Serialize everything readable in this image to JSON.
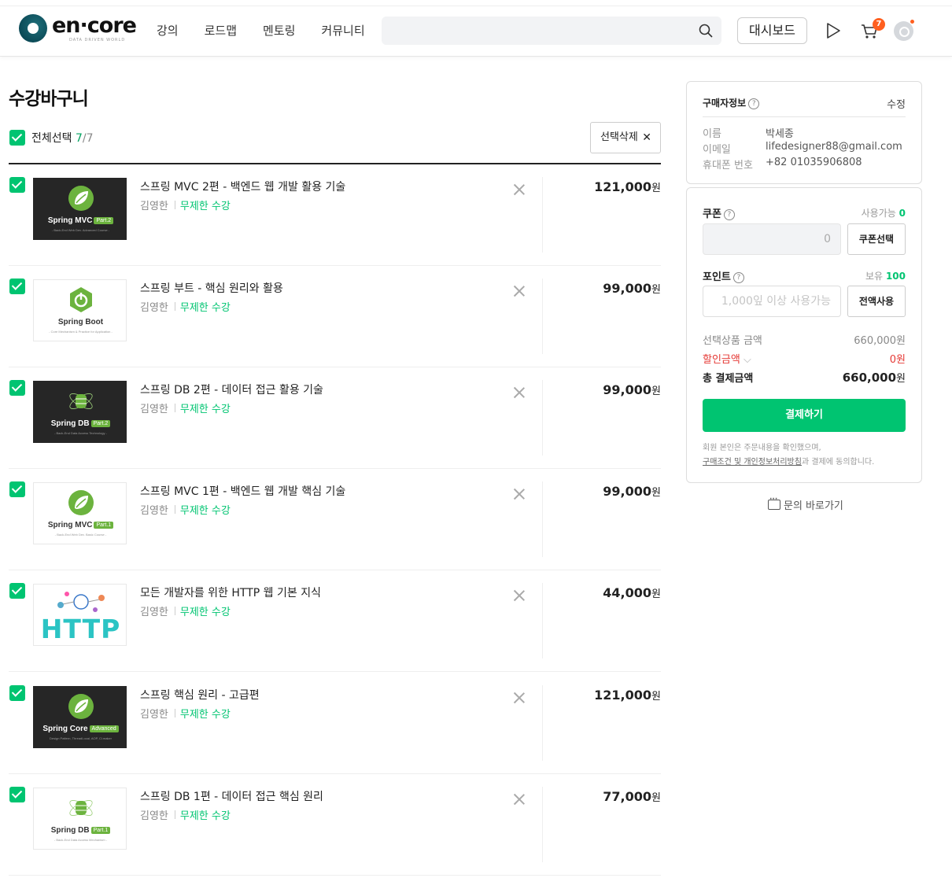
{
  "header": {
    "logo_text": "en·core",
    "logo_sub": "DATA DRIVEN WORLD",
    "nav": [
      "강의",
      "로드맵",
      "멘토링",
      "커뮤니티"
    ],
    "search_placeholder": "",
    "dashboard_label": "대시보드",
    "cart_count": "7",
    "icons": [
      "search-icon",
      "play-icon",
      "cart-icon",
      "avatar"
    ]
  },
  "cart": {
    "title": "수강바구니",
    "select_all_label": "전체선택",
    "selected_count": "7",
    "total_count": "/7",
    "delete_selected_label": "선택삭제",
    "items": [
      {
        "title": "스프링 MVC 2편 - 백엔드 웹 개발 활용 기술",
        "instructor": "김영한",
        "access": "무제한 수강",
        "price": "121,000",
        "currency": "원",
        "thumb": {
          "style": "dark",
          "label": "Spring MVC",
          "tag": "Part.2",
          "sub": "- Back-End Web Dev. Advanced Course -"
        }
      },
      {
        "title": "스프링 부트 - 핵심 원리와 활용",
        "instructor": "김영한",
        "access": "무제한 수강",
        "price": "99,000",
        "currency": "원",
        "thumb": {
          "style": "light",
          "label": "Spring Boot",
          "tag": "",
          "sub": "- Core Mechanism & Practice for Application -"
        }
      },
      {
        "title": "스프링 DB 2편 - 데이터 접근 활용 기술",
        "instructor": "김영한",
        "access": "무제한 수강",
        "price": "99,000",
        "currency": "원",
        "thumb": {
          "style": "dark",
          "label": "Spring DB",
          "tag": "Part.2",
          "sub": "- Back-End Data Access Technology -"
        }
      },
      {
        "title": "스프링 MVC 1편 - 백엔드 웹 개발 핵심 기술",
        "instructor": "김영한",
        "access": "무제한 수강",
        "price": "99,000",
        "currency": "원",
        "thumb": {
          "style": "light",
          "label": "Spring MVC",
          "tag": "Part.1",
          "sub": "- Back-End Web Dev. Basic Course -"
        }
      },
      {
        "title": "모든 개발자를 위한 HTTP 웹 기본 지식",
        "instructor": "김영한",
        "access": "무제한 수강",
        "price": "44,000",
        "currency": "원",
        "thumb": {
          "style": "http",
          "label": "HTTP",
          "tag": "",
          "sub": ""
        }
      },
      {
        "title": "스프링 핵심 원리 - 고급편",
        "instructor": "김영한",
        "access": "무제한 수강",
        "price": "121,000",
        "currency": "원",
        "thumb": {
          "style": "dark",
          "label": "Spring Core",
          "tag": "Advanced",
          "sub": "Design Pattern, ThreadLocal, AOP, Cl.maker"
        }
      },
      {
        "title": "스프링 DB 1편 - 데이터 접근 핵심 원리",
        "instructor": "김영한",
        "access": "무제한 수강",
        "price": "77,000",
        "currency": "원",
        "thumb": {
          "style": "light",
          "label": "Spring DB",
          "tag": "Part.1",
          "sub": "- Back-End Data Access Mechanism -"
        }
      }
    ]
  },
  "buyer": {
    "title": "구매자정보",
    "edit_label": "수정",
    "name_label": "이름",
    "name": "박세종",
    "email_label": "이메일",
    "email": "lifedesigner88@gmail.com",
    "phone_label": "휴대폰 번호",
    "phone": "+82 01035906808"
  },
  "payment": {
    "coupon_label": "쿠폰",
    "coupon_avail_label": "사용가능",
    "coupon_avail": "0",
    "coupon_value": "0",
    "coupon_button": "쿠폰선택",
    "point_label": "포인트",
    "point_avail_label": "보유",
    "point_avail": "100",
    "point_placeholder": "1,000잎 이상 사용가능",
    "point_button": "전액사용",
    "subtotal_label": "선택상품 금액",
    "subtotal": "660,000원",
    "discount_label": "할인금액",
    "discount": "0원",
    "total_label": "총 결제금액",
    "total": "660,000",
    "total_currency": "원",
    "pay_button": "결제하기",
    "notice_1": "회원 본인은 주문내용을 확인했으며,",
    "notice_link": "구매조건 및 개인정보처리방침",
    "notice_2": "과 결제에 동의합니다."
  },
  "inquiry_label": "문의 바로가기",
  "colors": {
    "accent": "#00c471",
    "badge": "#ff5f1f",
    "discount": "#e53935"
  }
}
